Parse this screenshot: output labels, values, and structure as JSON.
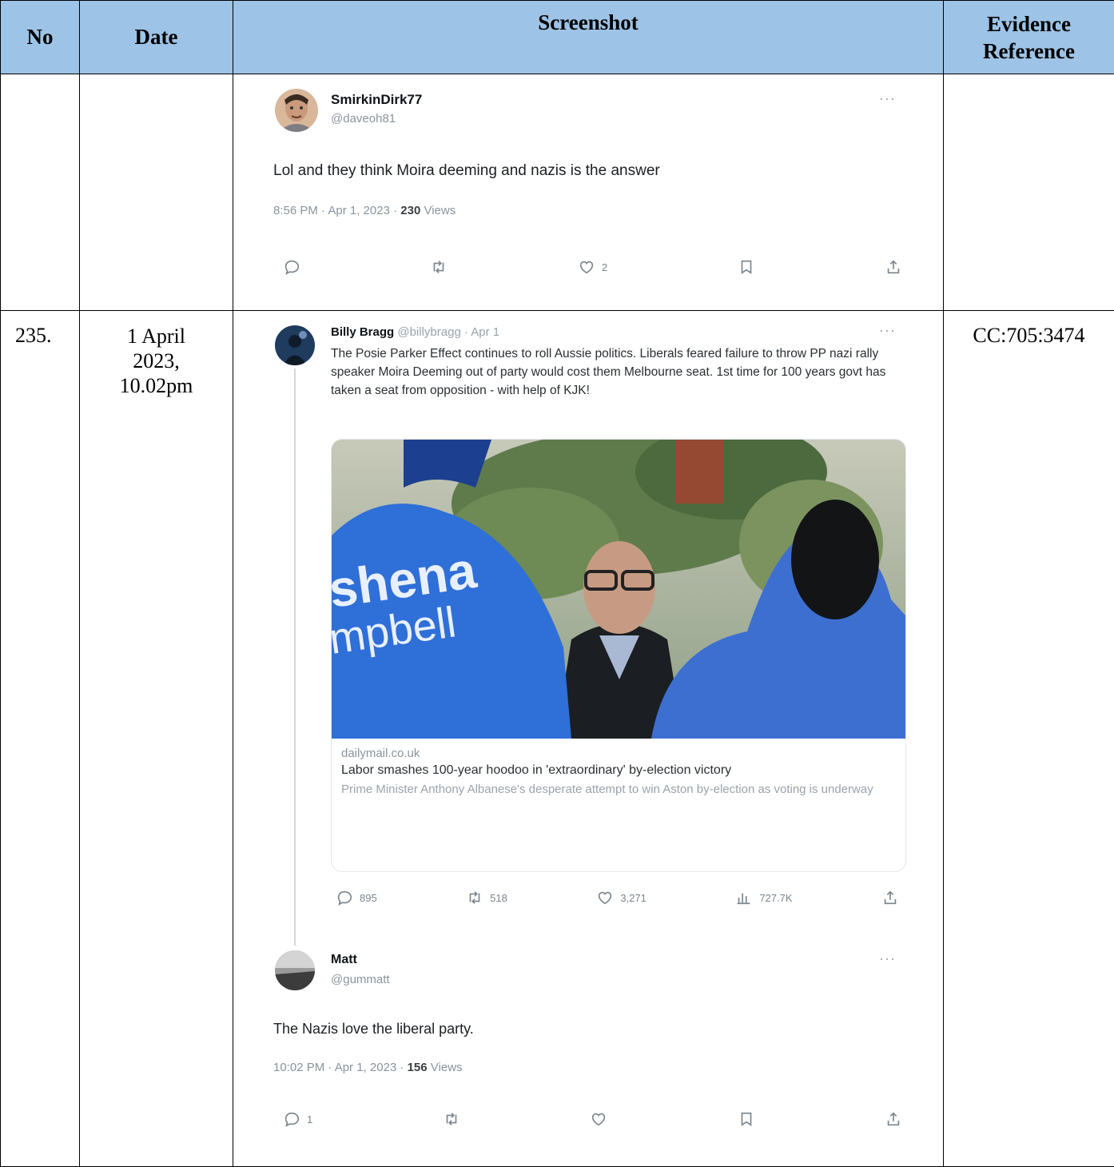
{
  "headers": {
    "no": "No",
    "date": "Date",
    "screenshot": "Screenshot",
    "ref": "Evidence Reference"
  },
  "rows": [
    {
      "no": "",
      "date": "",
      "ref": ""
    },
    {
      "no": "235.",
      "date": "1 April 2023, 10.02pm",
      "ref": "CC:705:3474"
    }
  ],
  "tweet1": {
    "name": "SmirkinDirk77",
    "handle": "@daveoh81",
    "text": "Lol and they think Moira deeming and nazis is the answer",
    "time": "8:56 PM · Apr 1, 2023 · ",
    "views": "230",
    "views_label": " Views",
    "likes": "2"
  },
  "tweet2": {
    "name": "Billy Bragg",
    "handle_date": " @billybragg · Apr 1",
    "text": "The Posie Parker Effect continues to roll Aussie politics. Liberals feared failure to throw PP nazi rally speaker Moira Deeming out of party would cost them Melbourne seat. 1st time for 100 years govt has taken a seat from opposition - with help of KJK!",
    "card_image_text_1": "shena",
    "card_image_text_2": "mpbell",
    "card_domain": "dailymail.co.uk",
    "card_title": "Labor smashes 100-year hoodoo in 'extraordinary' by-election victory",
    "card_desc": "Prime Minister Anthony Albanese's desperate attempt to win Aston by-election as voting is underway",
    "replies": "895",
    "retweets": "518",
    "likes": "3,271",
    "views": "727.7K"
  },
  "tweet3": {
    "name": "Matt",
    "handle": "@gummatt",
    "text": "The Nazis love the liberal party.",
    "time": "10:02 PM · Apr 1, 2023 · ",
    "views": "156",
    "views_label": " Views",
    "replies": "1"
  },
  "colors": {
    "header_bg": "#9dc3e6",
    "tweet_text": "#1b1f23",
    "muted": "#8a949e"
  }
}
